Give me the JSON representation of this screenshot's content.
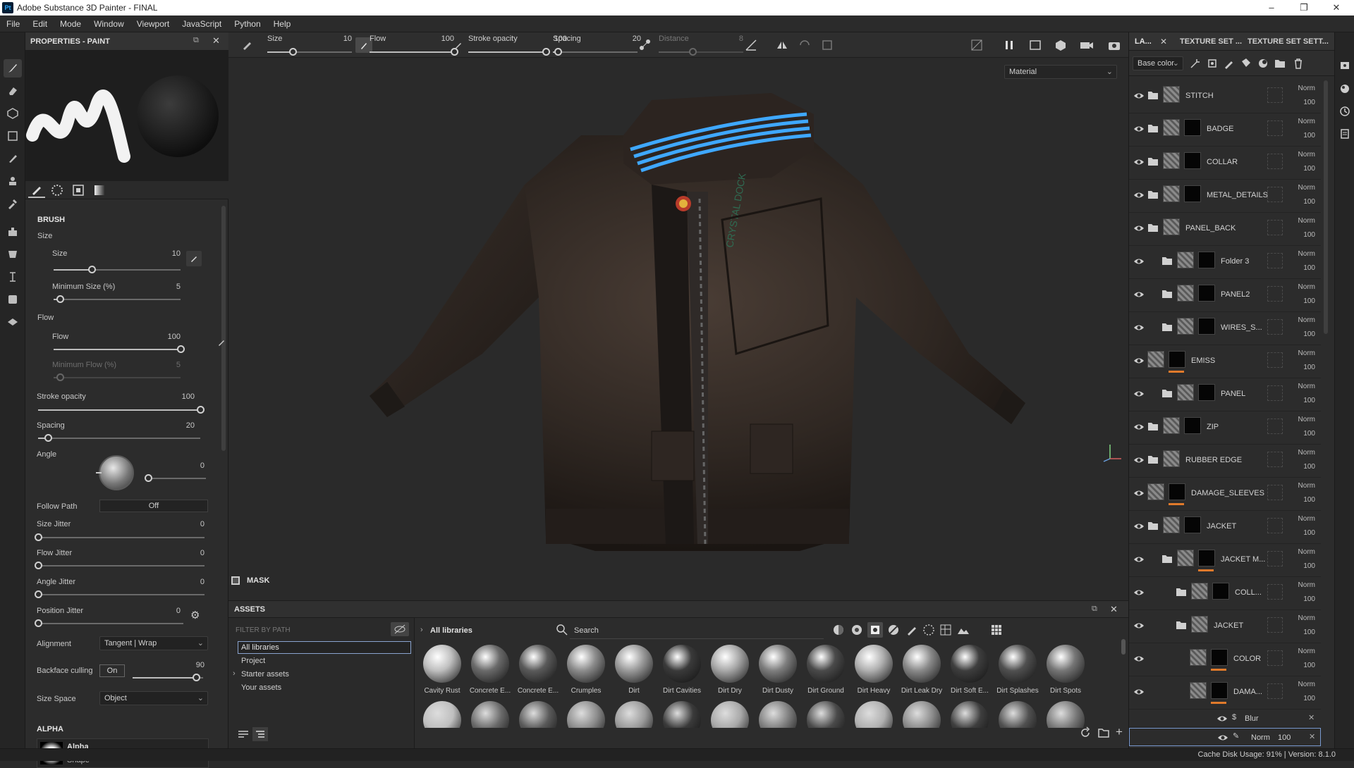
{
  "app": {
    "icon": "Pt",
    "title": "Adobe Substance 3D Painter - FINAL",
    "window_controls": [
      "–",
      "❐",
      "✕"
    ]
  },
  "menu": [
    "File",
    "Edit",
    "Mode",
    "Window",
    "Viewport",
    "JavaScript",
    "Python",
    "Help"
  ],
  "left_tools": [
    "paint-brush-icon",
    "eraser-icon",
    "projection-icon",
    "geometry-mask-icon",
    "smudge-icon",
    "clone-icon",
    "color-picker-icon",
    "bake-icon",
    "fill-icon",
    "measure-icon",
    "export-icon",
    "viewer-icon"
  ],
  "properties": {
    "title": "PROPERTIES - PAINT",
    "tabs": [
      "brush-tip-icon",
      "material-icon",
      "stencil-icon",
      "gradient-icon"
    ],
    "brush_section": "BRUSH",
    "size_group": "Size",
    "size_label": "Size",
    "size_value": "10",
    "size_fraction": 0.3,
    "min_size_label": "Minimum Size (%)",
    "min_size_value": "5",
    "min_size_fraction": 0.05,
    "flow_group": "Flow",
    "flow_label": "Flow",
    "flow_value": "100",
    "flow_fraction": 1.0,
    "min_flow_label": "Minimum Flow (%)",
    "min_flow_value": "5",
    "min_flow_fraction": 0.05,
    "stroke_opacity_label": "Stroke opacity",
    "stroke_opacity_value": "100",
    "stroke_opacity_fraction": 1.0,
    "spacing_label": "Spacing",
    "spacing_value": "20",
    "spacing_fraction": 0.06,
    "angle_label": "Angle",
    "angle_value": "0",
    "angle_fraction": 0.0,
    "follow_path_label": "Follow Path",
    "follow_path_value": "Off",
    "size_jitter_label": "Size Jitter",
    "size_jitter_value": "0",
    "flow_jitter_label": "Flow Jitter",
    "flow_jitter_value": "0",
    "angle_jitter_label": "Angle Jitter",
    "angle_jitter_value": "0",
    "position_jitter_label": "Position Jitter",
    "position_jitter_value": "0",
    "alignment_label": "Alignment",
    "alignment_value": "Tangent | Wrap",
    "backface_label": "Backface culling",
    "backface_toggle": "On",
    "backface_value": "90",
    "backface_fraction": 0.9,
    "size_space_label": "Size Space",
    "size_space_value": "Object",
    "alpha_section": "ALPHA",
    "alpha_name": "Alpha",
    "alpha_type": "Shape"
  },
  "viewport_toolbar": {
    "size_label": "Size",
    "size_value": "10",
    "size_fraction": 0.3,
    "flow_label": "Flow",
    "flow_value": "100",
    "flow_fraction": 1.0,
    "stroke_label": "Stroke opacity",
    "stroke_value": "100",
    "stroke_fraction": 1.0,
    "spacing_label": "Spacing",
    "spacing_value": "20",
    "spacing_fraction": 0.06,
    "distance_label": "Distance",
    "distance_value": "8",
    "distance_fraction": 0.4
  },
  "viewport": {
    "display_mode": "Material",
    "mask_label": "MASK",
    "patch_text": "CRYSTAL DOCK"
  },
  "assets": {
    "title": "ASSETS",
    "filter_placeholder": "FILTER BY PATH",
    "tree": [
      "All libraries",
      "Project",
      "Starter assets",
      "Your assets"
    ],
    "breadcrumb": "All libraries",
    "search_placeholder": "Search",
    "items": [
      {
        "name": "Cavity Rust",
        "tone": "#bfbfbf"
      },
      {
        "name": "Concrete E...",
        "tone": "#6a6a6a"
      },
      {
        "name": "Concrete E...",
        "tone": "#5a5a5a"
      },
      {
        "name": "Crumples",
        "tone": "#8c8c8c"
      },
      {
        "name": "Dirt",
        "tone": "#9a9a9a"
      },
      {
        "name": "Dirt Cavities",
        "tone": "#3a3a3a"
      },
      {
        "name": "Dirt Dry",
        "tone": "#a8a8a8"
      },
      {
        "name": "Dirt Dusty",
        "tone": "#7e7e7e"
      },
      {
        "name": "Dirt Ground",
        "tone": "#4a4a4a"
      },
      {
        "name": "Dirt Heavy",
        "tone": "#b0b0b0"
      },
      {
        "name": "Dirt Leak Dry",
        "tone": "#8a8a8a"
      },
      {
        "name": "Dirt Soft E...",
        "tone": "#3e3e3e"
      },
      {
        "name": "Dirt Splashes",
        "tone": "#505050"
      },
      {
        "name": "Dirt Spots",
        "tone": "#767676"
      }
    ]
  },
  "layers_panel": {
    "tabs": [
      "LA...",
      "TEXTURE SET ...",
      "TEXTURE SET SETT..."
    ],
    "channel": "Base color",
    "layers": [
      {
        "name": "STITCH",
        "blend": "Norm",
        "opacity": "100",
        "indent": 0,
        "folder": true,
        "mask": false,
        "orange": false
      },
      {
        "name": "BADGE",
        "blend": "Norm",
        "opacity": "100",
        "indent": 0,
        "folder": true,
        "mask": true,
        "orange": false
      },
      {
        "name": "COLLAR",
        "blend": "Norm",
        "opacity": "100",
        "indent": 0,
        "folder": true,
        "mask": true,
        "orange": false
      },
      {
        "name": "METAL_DETAILS",
        "blend": "Norm",
        "opacity": "100",
        "indent": 0,
        "folder": true,
        "mask": true,
        "orange": false
      },
      {
        "name": "PANEL_BACK",
        "blend": "Norm",
        "opacity": "100",
        "indent": 0,
        "folder": true,
        "mask": false,
        "orange": false
      },
      {
        "name": "Folder 3",
        "blend": "Norm",
        "opacity": "100",
        "indent": 1,
        "folder": true,
        "mask": true,
        "orange": false
      },
      {
        "name": "PANEL2",
        "blend": "Norm",
        "opacity": "100",
        "indent": 1,
        "folder": true,
        "mask": true,
        "orange": false
      },
      {
        "name": "WIRES_S...",
        "blend": "Norm",
        "opacity": "100",
        "indent": 1,
        "folder": true,
        "mask": true,
        "orange": false
      },
      {
        "name": "EMISS",
        "blend": "Norm",
        "opacity": "100",
        "indent": 0,
        "folder": false,
        "mask": true,
        "orange": true
      },
      {
        "name": "PANEL",
        "blend": "Norm",
        "opacity": "100",
        "indent": 1,
        "folder": true,
        "mask": true,
        "orange": false
      },
      {
        "name": "ZIP",
        "blend": "Norm",
        "opacity": "100",
        "indent": 0,
        "folder": true,
        "mask": true,
        "orange": false
      },
      {
        "name": "RUBBER EDGE",
        "blend": "Norm",
        "opacity": "100",
        "indent": 0,
        "folder": true,
        "mask": false,
        "orange": false
      },
      {
        "name": "DAMAGE_SLEEVES",
        "blend": "Norm",
        "opacity": "100",
        "indent": 0,
        "folder": false,
        "mask": true,
        "orange": true
      },
      {
        "name": "JACKET",
        "blend": "Norm",
        "opacity": "100",
        "indent": 0,
        "folder": true,
        "mask": true,
        "orange": false
      },
      {
        "name": "JACKET M...",
        "blend": "Norm",
        "opacity": "100",
        "indent": 1,
        "folder": true,
        "mask": true,
        "orange": true
      },
      {
        "name": "COLL...",
        "blend": "Norm",
        "opacity": "100",
        "indent": 2,
        "folder": true,
        "mask": true,
        "orange": false
      },
      {
        "name": "JACKET",
        "blend": "Norm",
        "opacity": "100",
        "indent": 2,
        "folder": true,
        "mask": false,
        "orange": false
      },
      {
        "name": "COLOR",
        "blend": "Norm",
        "opacity": "100",
        "indent": 3,
        "folder": false,
        "mask": true,
        "orange": true
      },
      {
        "name": "DAMA...",
        "blend": "Norm",
        "opacity": "100",
        "indent": 3,
        "folder": false,
        "mask": true,
        "orange": true
      }
    ],
    "effects": [
      {
        "name": "Blur"
      },
      {
        "name": "",
        "blend": "Norm",
        "opacity": "100"
      }
    ]
  },
  "status": {
    "text": "Cache Disk Usage:  91% | Version: 8.1.0"
  }
}
